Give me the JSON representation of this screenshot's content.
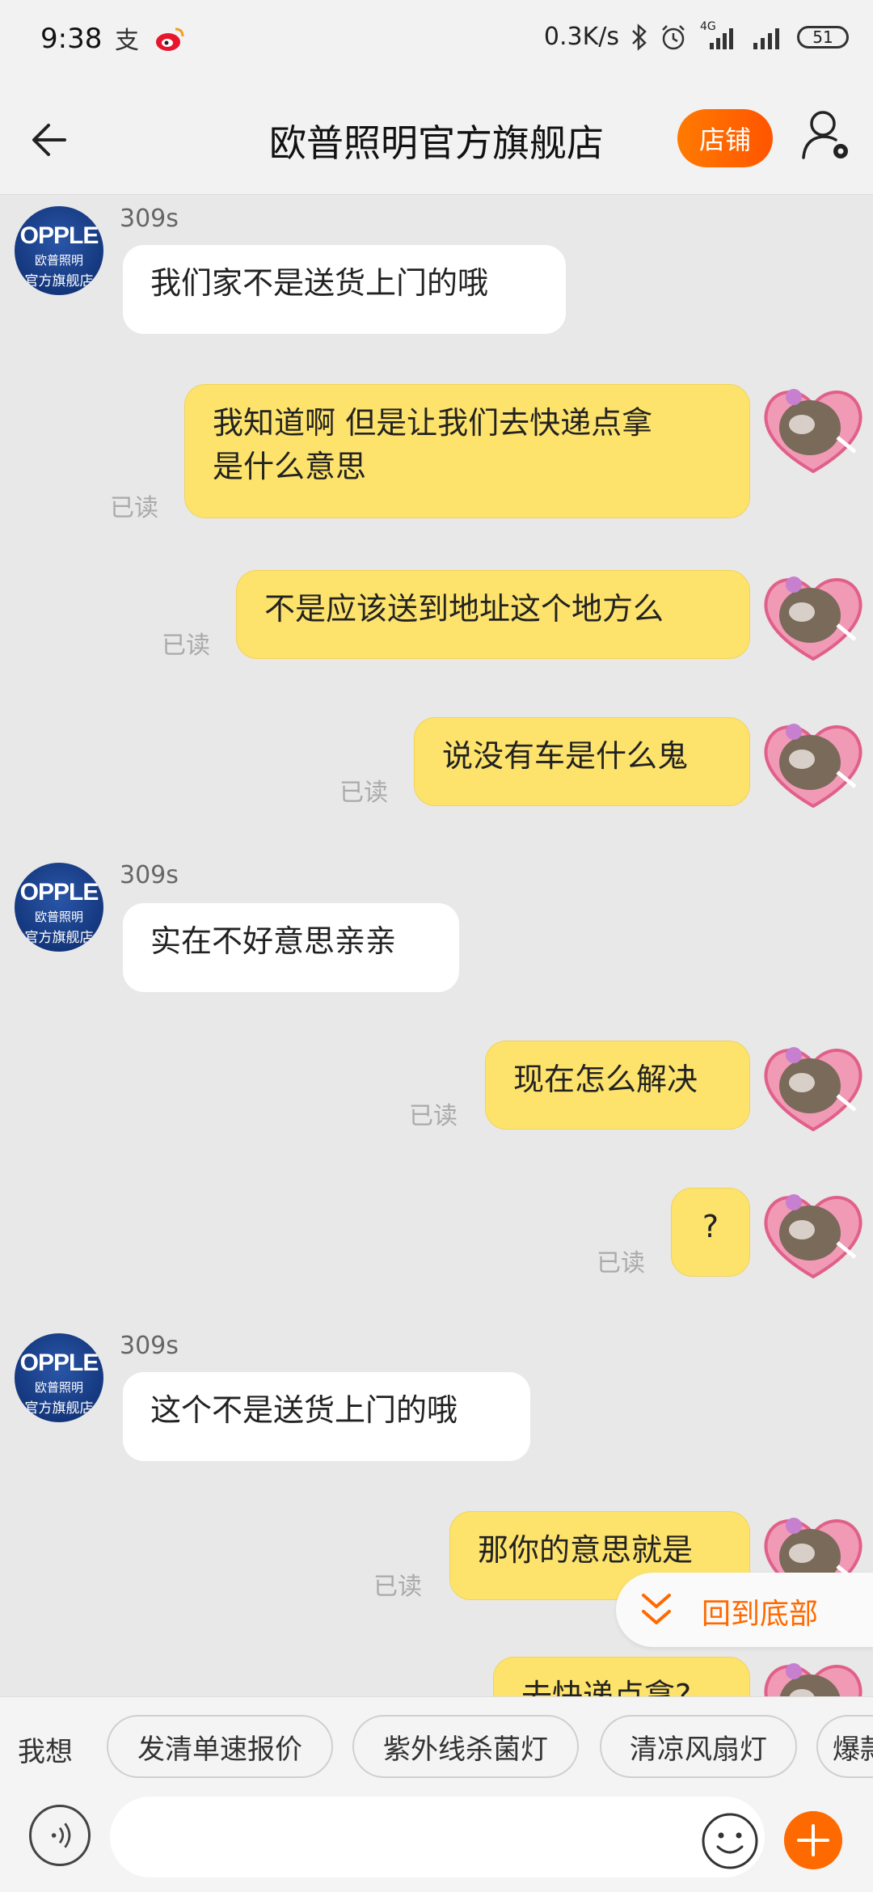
{
  "status_bar": {
    "time": "9:38",
    "network_speed": "0.3K/s",
    "network_type": "4G",
    "battery": "51",
    "icons": [
      "alipay-icon",
      "weibo-icon",
      "bluetooth-icon",
      "alarm-icon",
      "signal-icon",
      "signal-icon-2",
      "battery-icon"
    ]
  },
  "header": {
    "title": "欧普照明官方旗舰店",
    "shop_button": "店铺",
    "back_icon": "back-arrow-icon",
    "settings_icon": "user-settings-icon"
  },
  "shop_avatar": {
    "brand": "OPPLE",
    "line2": "欧普照明",
    "line3": "官方旗舰店"
  },
  "messages": [
    {
      "side": "left",
      "sender": "309s",
      "text": "我们家不是送货上门的哦"
    },
    {
      "side": "right",
      "text": "我知道啊 但是让我们去快递点拿\n是什么意思",
      "status": "已读"
    },
    {
      "side": "right",
      "text": "不是应该送到地址这个地方么",
      "status": "已读"
    },
    {
      "side": "right",
      "text": "说没有车是什么鬼",
      "status": "已读"
    },
    {
      "side": "left",
      "sender": "309s",
      "text": "实在不好意思亲亲"
    },
    {
      "side": "right",
      "text": "现在怎么解决",
      "status": "已读"
    },
    {
      "side": "right",
      "text": "?",
      "status": "已读"
    },
    {
      "side": "left",
      "sender": "309s",
      "text": "这个不是送货上门的哦"
    },
    {
      "side": "right",
      "text": "那你的意思就是",
      "status": "已读"
    },
    {
      "side": "right",
      "text": "去快递点拿?"
    }
  ],
  "back_to_bottom": "回到底部",
  "suggestions": {
    "label": "我想",
    "chips": [
      "发清单速报价",
      "紫外线杀菌灯",
      "清凉风扇灯",
      "爆款"
    ]
  },
  "input_bar": {
    "voice_icon": "voice-icon",
    "emoji_icon": "emoji-icon",
    "plus_icon": "plus-icon",
    "value": ""
  },
  "colors": {
    "accent": "#ff6a00",
    "bubble_mine": "#fde36c",
    "bubble_theirs": "#ffffff",
    "background": "#e8e8e8"
  }
}
